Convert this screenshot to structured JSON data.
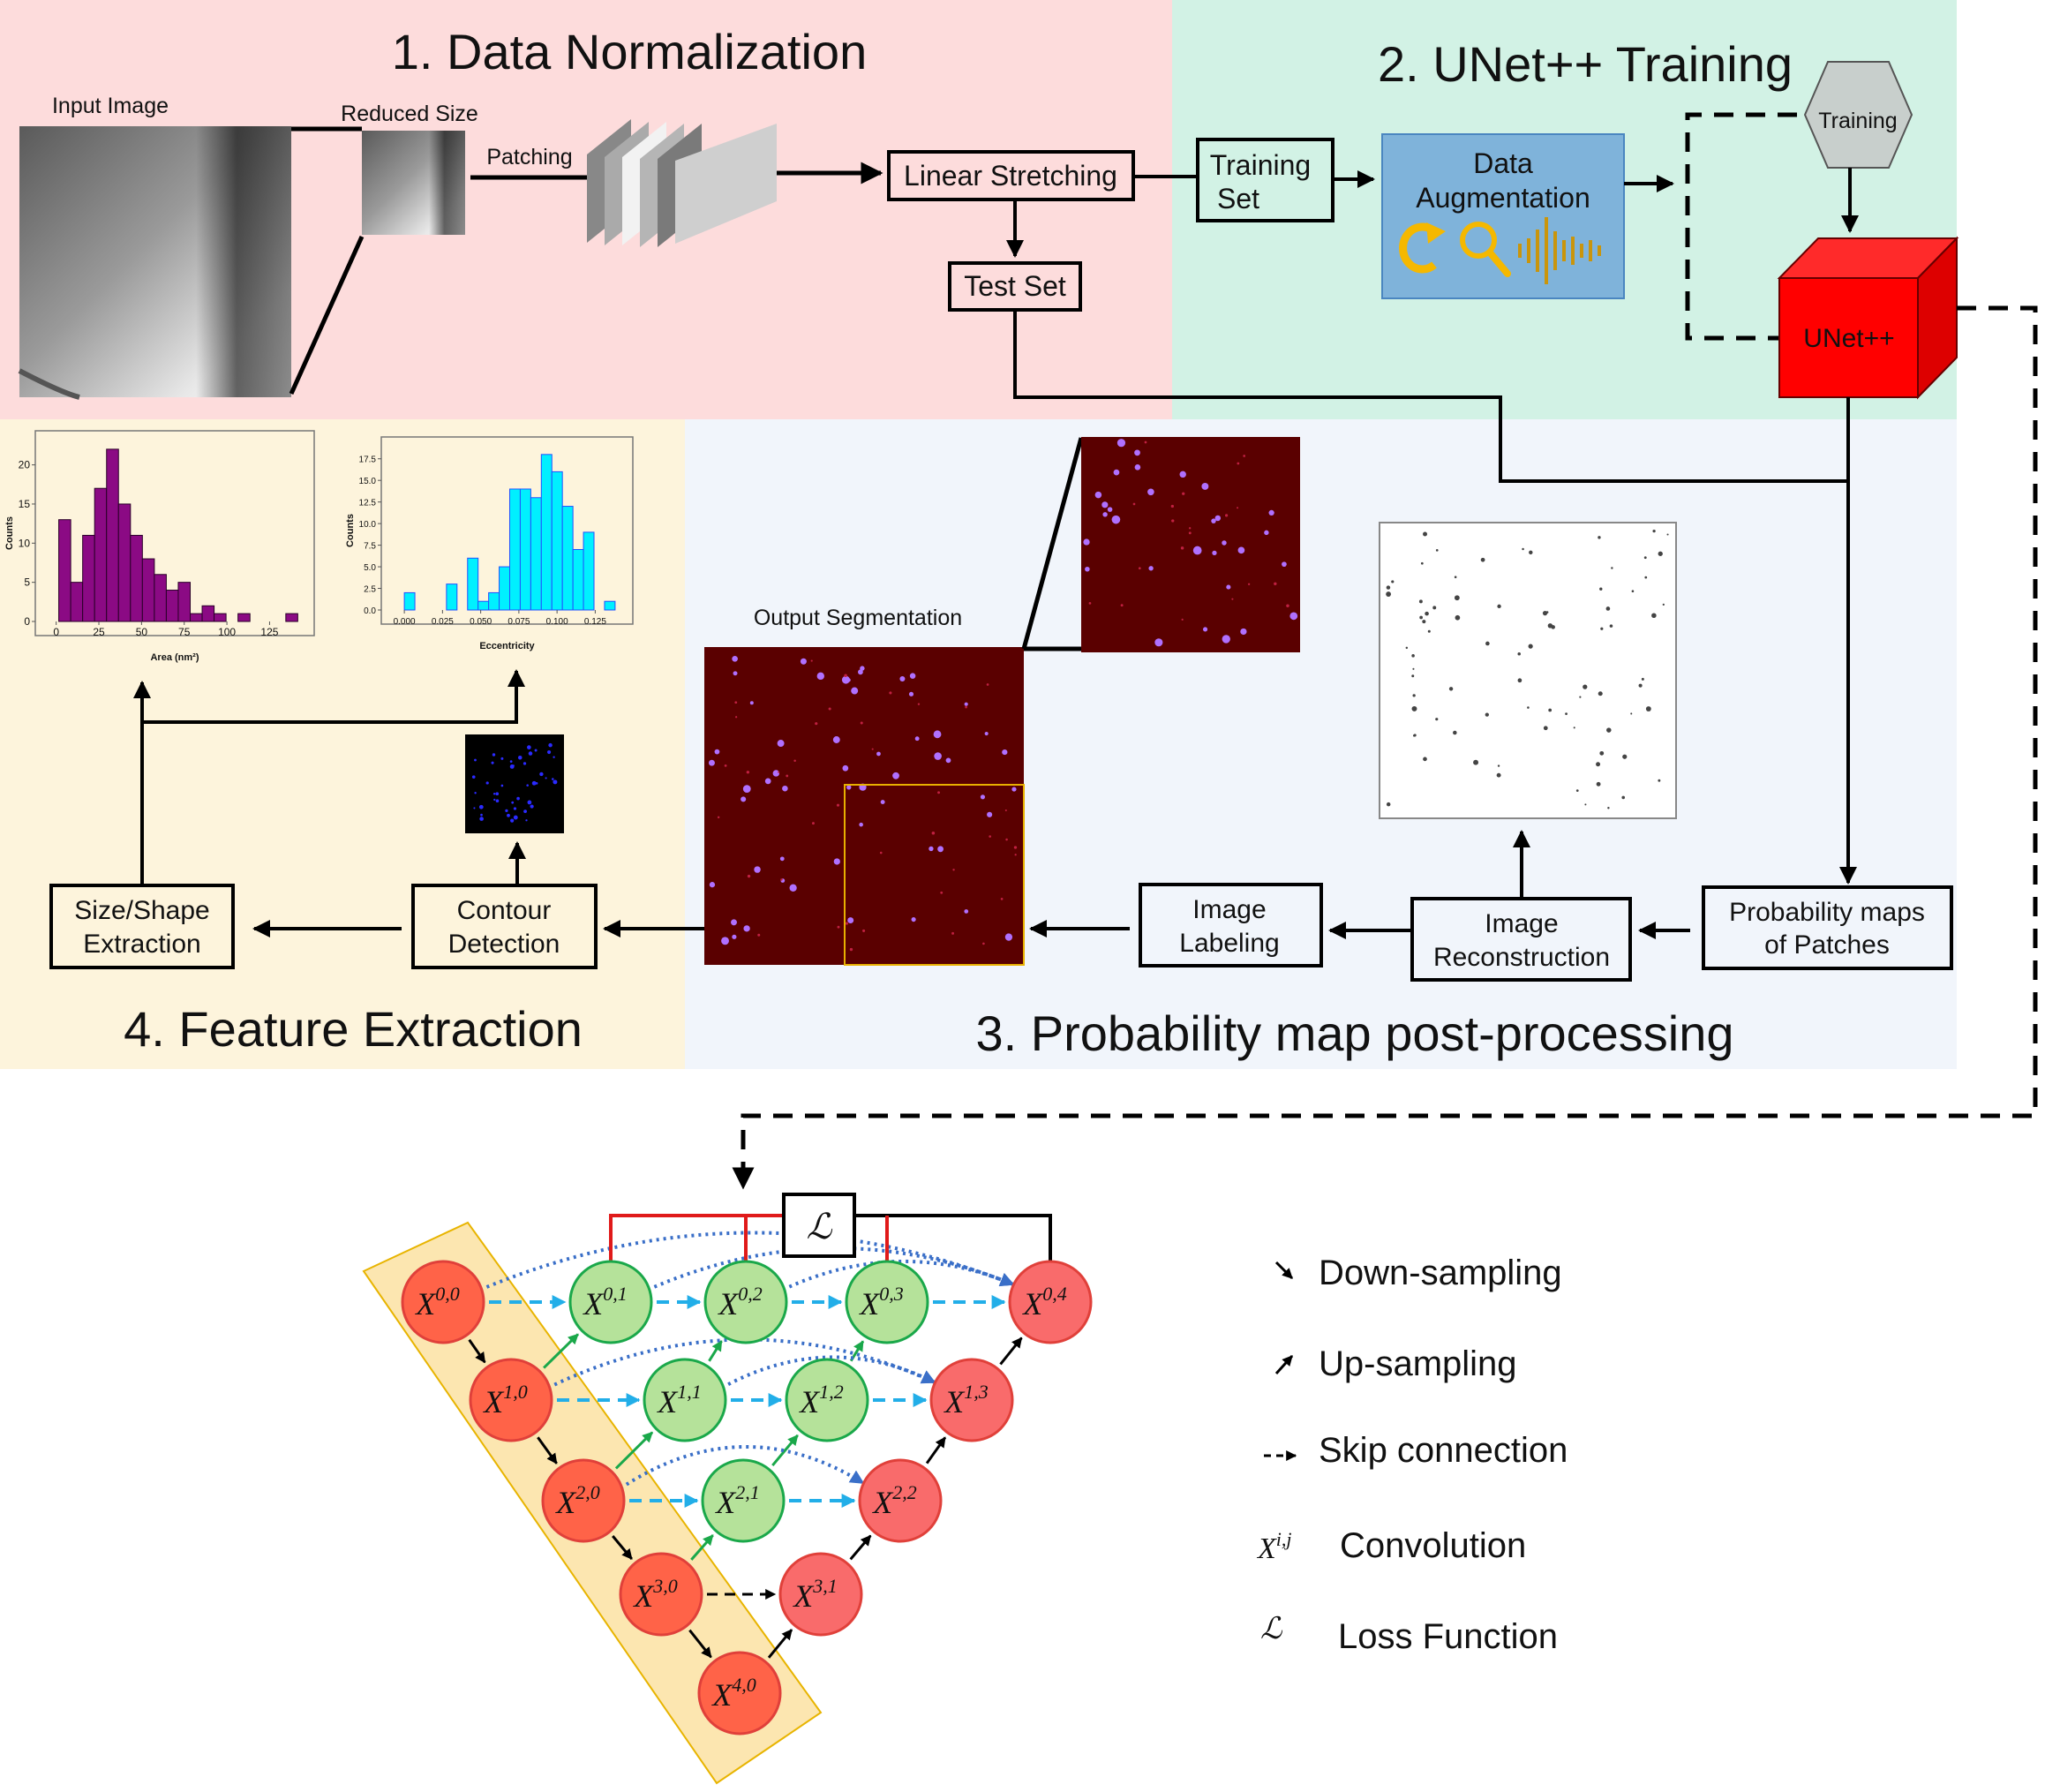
{
  "sections": {
    "s1": {
      "title": "1. Data Normalization",
      "color": "#fddcdc"
    },
    "s2": {
      "title": "2. UNet++ Training",
      "color": "#d2f2e5"
    },
    "s3": {
      "title": "3. Probability map post-processing",
      "color": "#f1f5fb"
    },
    "s4": {
      "title": "4. Feature Extraction",
      "color": "#fdf4dc"
    }
  },
  "labels": {
    "input_image": "Input Image",
    "reduced_size": "Reduced Size",
    "patching": "Patching",
    "output_segmentation": "Output Segmentation"
  },
  "boxes": {
    "linear_stretching": "Linear Stretching",
    "test_set": "Test Set",
    "training_set": [
      "Training",
      "Set"
    ],
    "data_augmentation": [
      "Data",
      "Augmentation"
    ],
    "training_hex": "Training",
    "unet": "UNet++",
    "probability_maps": [
      "Probability maps",
      "of Patches"
    ],
    "image_reconstruction": [
      "Image",
      "Reconstruction"
    ],
    "image_labeling": [
      "Image",
      "Labeling"
    ],
    "contour_detection": [
      "Contour",
      "Detection"
    ],
    "size_shape_extraction": [
      "Size/Shape",
      "Extraction"
    ]
  },
  "colors": {
    "unet_red": "#ff0000",
    "augment_blue": "#7fb3da",
    "augment_icon": "#f5b800",
    "hex_gray": "#c8cfcc",
    "seg_bg": "#5a0000",
    "seg_dot": "#b070ff",
    "node_encoder": "#ff6348",
    "node_decoder": "#f96b6b",
    "node_nested": "#b5e29a",
    "node_nested_stroke": "#1aa84a",
    "encoder_band": "#fce6b0",
    "skip_blue": "#22aee8",
    "dense_blue": "#3a6fc8",
    "up_green": "#1aa84a",
    "deep_sup_red": "#e01a1a"
  },
  "chart_data": [
    {
      "type": "bar",
      "title": "",
      "xlabel": "Area (nm²)",
      "ylabel": "Counts",
      "bin_edges": [
        1.5,
        8.5,
        15.5,
        22.5,
        29.5,
        36.5,
        43.5,
        50.5,
        57.5,
        64.5,
        71.5,
        78.5,
        85.5,
        92.5,
        99.5,
        106.5,
        113.5,
        120.5,
        127.5,
        134.5,
        141.5
      ],
      "values": [
        13,
        5,
        11,
        17,
        22,
        15,
        11,
        8,
        6,
        4,
        5,
        1,
        2,
        1,
        0,
        1,
        0,
        0,
        0,
        1
      ],
      "xticks": [
        "0",
        "25",
        "50",
        "75",
        "100",
        "125"
      ],
      "xtick_values": [
        0,
        25,
        50,
        75,
        100,
        125
      ],
      "yticks": [
        "0",
        "5",
        "10",
        "15",
        "20"
      ],
      "ytick_values": [
        0,
        5,
        10,
        15,
        20
      ],
      "xlim": [
        -5,
        147
      ],
      "ylim": [
        0,
        23
      ],
      "bar_color": "#8b0a84",
      "grid": false
    },
    {
      "type": "bar",
      "title": "",
      "xlabel": "Eccentricity",
      "ylabel": "Counts",
      "bin_edges": [
        0.0,
        0.0069,
        0.0138,
        0.0207,
        0.0276,
        0.0345,
        0.0414,
        0.0483,
        0.0552,
        0.0621,
        0.069,
        0.0759,
        0.0828,
        0.0897,
        0.0966,
        0.1035,
        0.1104,
        0.1173,
        0.1242,
        0.1311,
        0.138
      ],
      "values": [
        2,
        0,
        0,
        0,
        3,
        0,
        6,
        1,
        2,
        5,
        14,
        14,
        13,
        18,
        16,
        12,
        7,
        9,
        0,
        1
      ],
      "xticks": [
        "0.000",
        "0.025",
        "0.050",
        "0.075",
        "0.100",
        "0.125"
      ],
      "xtick_values": [
        0,
        0.025,
        0.05,
        0.075,
        0.1,
        0.125
      ],
      "yticks": [
        "0.0",
        "2.5",
        "5.0",
        "7.5",
        "10.0",
        "12.5",
        "15.0",
        "17.5"
      ],
      "ytick_values": [
        0,
        2.5,
        5,
        7.5,
        10,
        12.5,
        15,
        17.5
      ],
      "xlim": [
        -0.007,
        0.145
      ],
      "ylim": [
        0,
        18.8
      ],
      "bar_color": "#00f0ff",
      "grid": false
    }
  ],
  "unet": {
    "nodes": [
      {
        "id": "00",
        "label": "X",
        "sup": "0,0",
        "kind": "encoder"
      },
      {
        "id": "10",
        "label": "X",
        "sup": "1,0",
        "kind": "encoder"
      },
      {
        "id": "20",
        "label": "X",
        "sup": "2,0",
        "kind": "encoder"
      },
      {
        "id": "30",
        "label": "X",
        "sup": "3,0",
        "kind": "encoder"
      },
      {
        "id": "40",
        "label": "X",
        "sup": "4,0",
        "kind": "encoder"
      },
      {
        "id": "01",
        "label": "X",
        "sup": "0,1",
        "kind": "nested"
      },
      {
        "id": "02",
        "label": "X",
        "sup": "0,2",
        "kind": "nested"
      },
      {
        "id": "03",
        "label": "X",
        "sup": "0,3",
        "kind": "nested"
      },
      {
        "id": "11",
        "label": "X",
        "sup": "1,1",
        "kind": "nested"
      },
      {
        "id": "12",
        "label": "X",
        "sup": "1,2",
        "kind": "nested"
      },
      {
        "id": "21",
        "label": "X",
        "sup": "2,1",
        "kind": "nested"
      },
      {
        "id": "04",
        "label": "X",
        "sup": "0,4",
        "kind": "decoder"
      },
      {
        "id": "13",
        "label": "X",
        "sup": "1,3",
        "kind": "decoder"
      },
      {
        "id": "22",
        "label": "X",
        "sup": "2,2",
        "kind": "decoder"
      },
      {
        "id": "31",
        "label": "X",
        "sup": "3,1",
        "kind": "decoder"
      }
    ],
    "loss_symbol": "ℒ"
  },
  "legend": [
    {
      "symbol": "down-arrow",
      "label": "Down-sampling"
    },
    {
      "symbol": "up-arrow",
      "label": "Up-sampling"
    },
    {
      "symbol": "skip-arrow",
      "label": "Skip connection"
    },
    {
      "symbol": "X",
      "sup": "i,j",
      "label": "Convolution"
    },
    {
      "symbol": "ℒ",
      "label": "Loss Function"
    }
  ]
}
